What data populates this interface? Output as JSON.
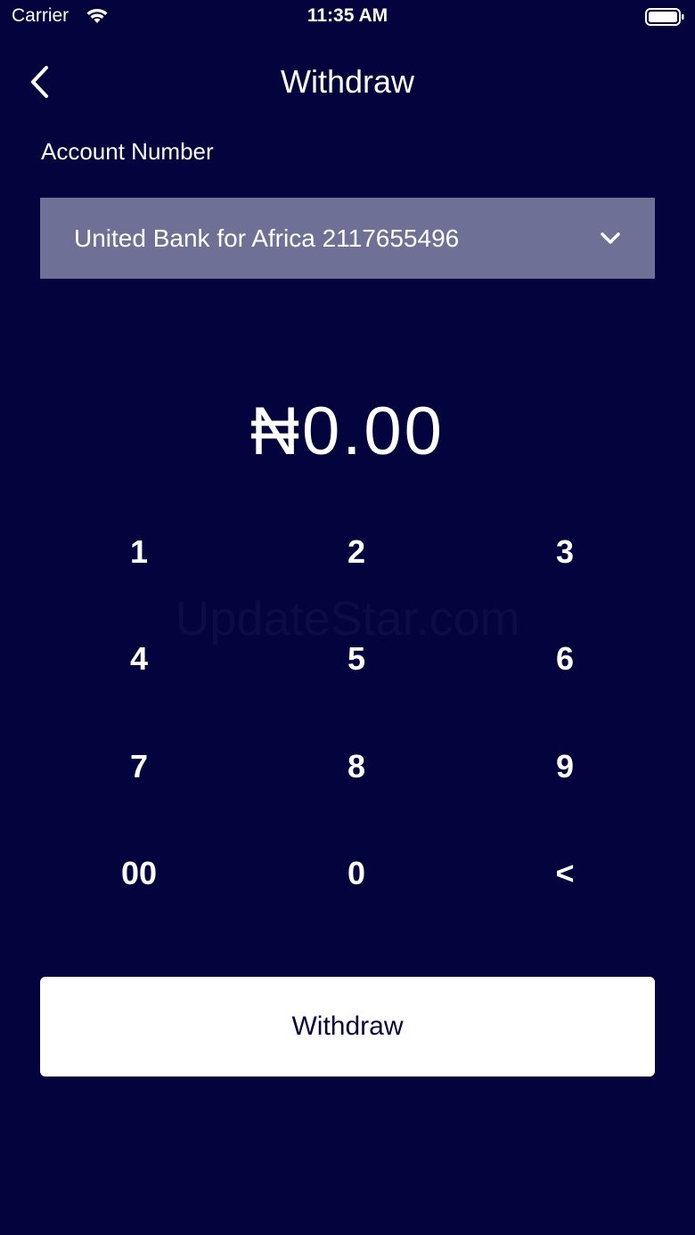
{
  "status_bar": {
    "carrier": "Carrier",
    "time": "11:35 AM",
    "icons": [
      "wifi-icon",
      "battery-icon"
    ]
  },
  "nav": {
    "back_icon": "chevron-left-icon",
    "title": "Withdraw"
  },
  "account": {
    "label": "Account Number",
    "selected": "United Bank for Africa 2117655496",
    "dropdown_icon": "chevron-down-icon"
  },
  "amount": {
    "value": "₦0.00"
  },
  "keypad": {
    "keys": [
      "1",
      "2",
      "3",
      "4",
      "5",
      "6",
      "7",
      "8",
      "9",
      "00",
      "0",
      "<"
    ]
  },
  "watermark": "UpdateStar.com",
  "actions": {
    "withdraw_label": "Withdraw"
  },
  "colors": {
    "background": "#03033d",
    "dropdown": "#6f7096",
    "button": "#ffffff",
    "text": "#ffffff"
  }
}
